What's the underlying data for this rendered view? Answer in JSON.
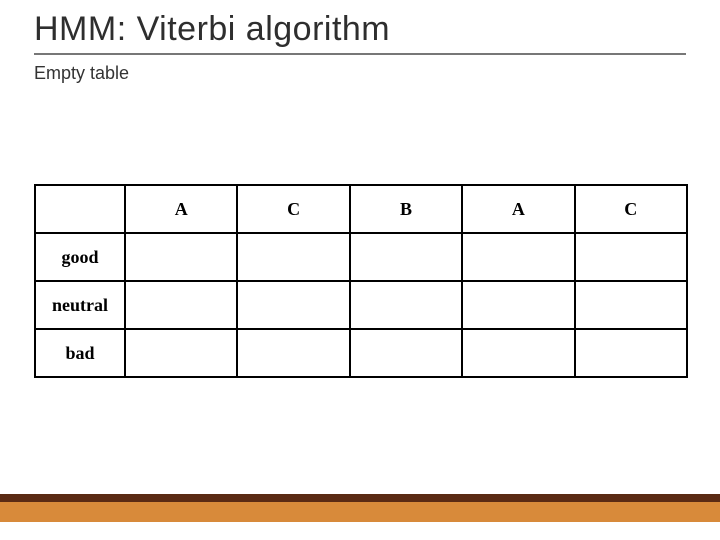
{
  "title": "HMM: Viterbi algorithm",
  "subtitle": "Empty table",
  "table": {
    "columns": [
      "A",
      "C",
      "B",
      "A",
      "C"
    ],
    "rows": [
      {
        "label": "good",
        "cells": [
          "",
          "",
          "",
          "",
          ""
        ]
      },
      {
        "label": "neutral",
        "cells": [
          "",
          "",
          "",
          "",
          ""
        ]
      },
      {
        "label": "bad",
        "cells": [
          "",
          "",
          "",
          "",
          ""
        ]
      }
    ]
  },
  "chart_data": {
    "type": "table",
    "title": "HMM: Viterbi algorithm — Empty table",
    "columns": [
      "",
      "A",
      "C",
      "B",
      "A",
      "C"
    ],
    "rows": [
      [
        "good",
        "",
        "",
        "",
        "",
        ""
      ],
      [
        "neutral",
        "",
        "",
        "",
        "",
        ""
      ],
      [
        "bad",
        "",
        "",
        "",
        "",
        ""
      ]
    ]
  },
  "footer": {
    "accentDark": "#5a2a14",
    "accentOrange": "#d88a3a"
  }
}
